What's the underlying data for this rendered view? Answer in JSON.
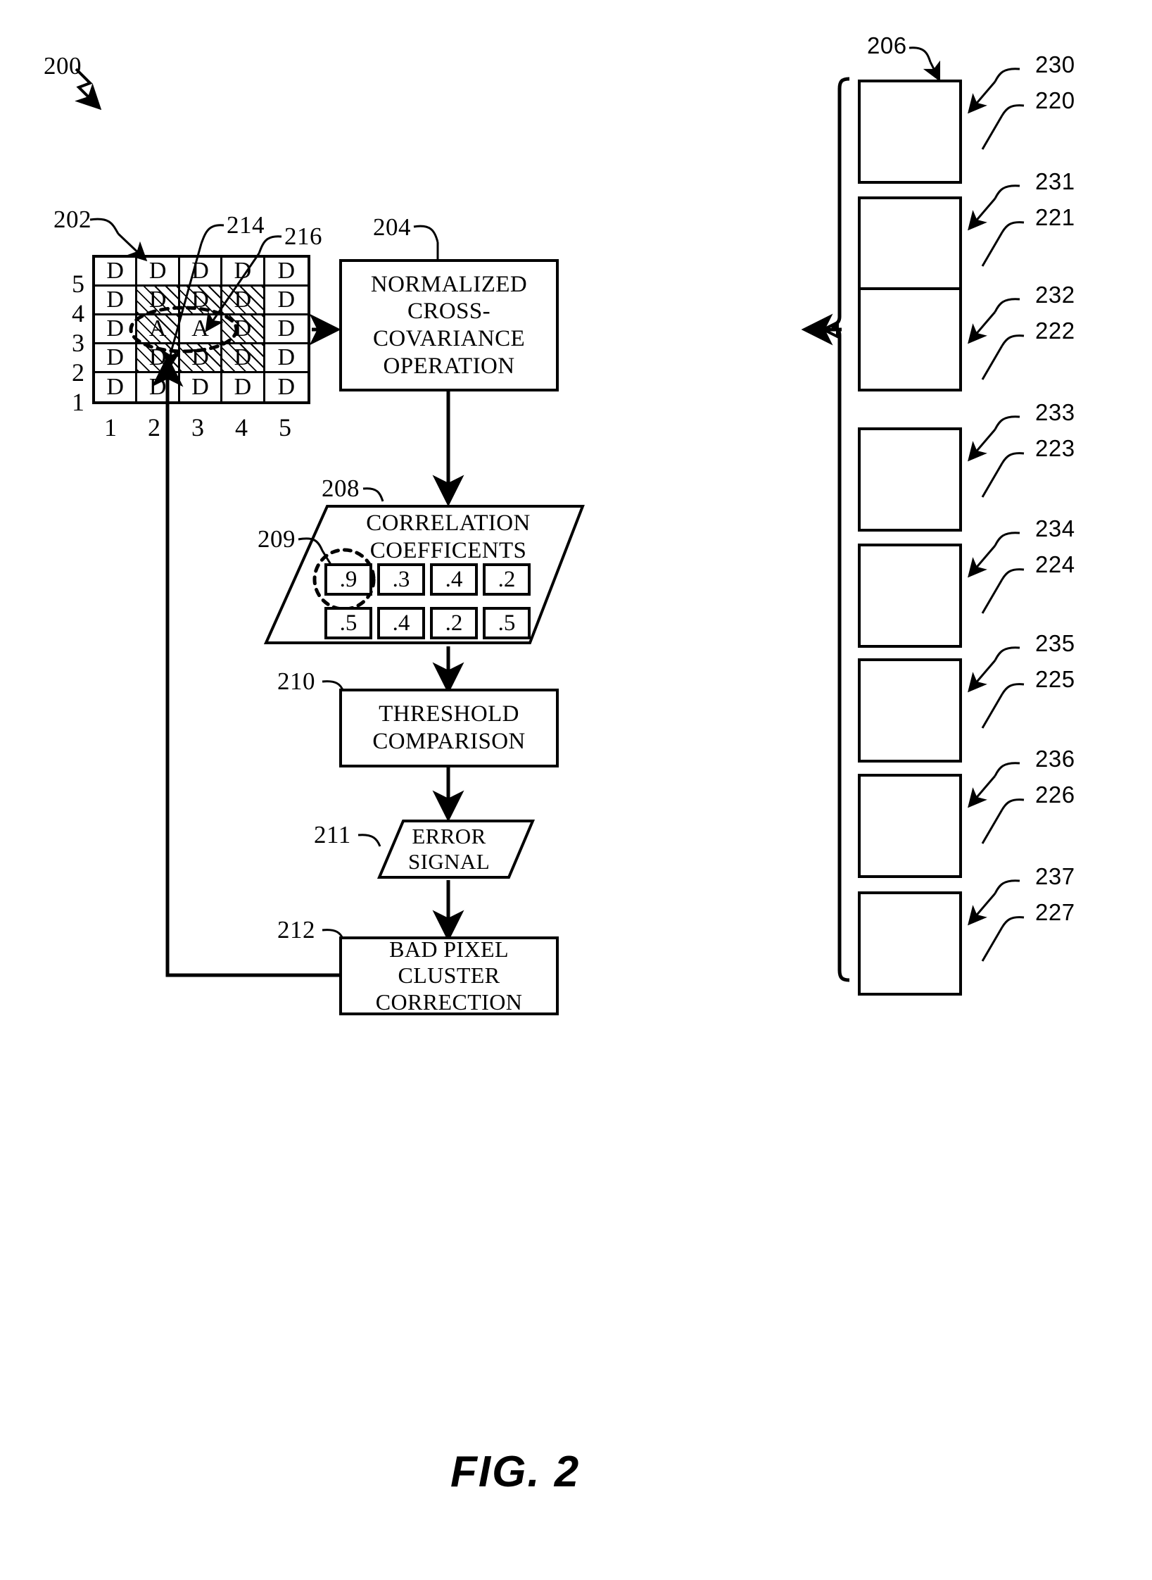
{
  "figure": {
    "caption": "FIG. 2",
    "top_ref": "200"
  },
  "pixel_grid": {
    "ref": "202",
    "callouts": [
      {
        "ref": "214"
      },
      {
        "ref": "216"
      }
    ],
    "row_labels": [
      "5",
      "4",
      "3",
      "2",
      "1"
    ],
    "col_labels": [
      "1",
      "2",
      "3",
      "4",
      "5"
    ],
    "rows": [
      {
        "label": "5",
        "cells": [
          {
            "text": "D",
            "hatched": false
          },
          {
            "text": "D",
            "hatched": false
          },
          {
            "text": "D",
            "hatched": false
          },
          {
            "text": "D",
            "hatched": false
          },
          {
            "text": "D",
            "hatched": false
          }
        ]
      },
      {
        "label": "4",
        "cells": [
          {
            "text": "D",
            "hatched": false
          },
          {
            "text": "D",
            "hatched": true
          },
          {
            "text": "D",
            "hatched": true
          },
          {
            "text": "D",
            "hatched": true
          },
          {
            "text": "D",
            "hatched": false
          }
        ]
      },
      {
        "label": "3",
        "cells": [
          {
            "text": "D",
            "hatched": false
          },
          {
            "text": "A",
            "hatched": true
          },
          {
            "text": "A",
            "hatched": false
          },
          {
            "text": "D",
            "hatched": true
          },
          {
            "text": "D",
            "hatched": false
          }
        ]
      },
      {
        "label": "2",
        "cells": [
          {
            "text": "D",
            "hatched": false
          },
          {
            "text": "D",
            "hatched": true
          },
          {
            "text": "D",
            "hatched": true
          },
          {
            "text": "D",
            "hatched": true
          },
          {
            "text": "D",
            "hatched": false
          }
        ]
      },
      {
        "label": "1",
        "cells": [
          {
            "text": "D",
            "hatched": false
          },
          {
            "text": "D",
            "hatched": false
          },
          {
            "text": "D",
            "hatched": false
          },
          {
            "text": "D",
            "hatched": false
          },
          {
            "text": "D",
            "hatched": false
          }
        ]
      }
    ]
  },
  "blocks": {
    "ncc": {
      "ref": "204",
      "label": "NORMALIZED\nCROSS-\nCOVARIANCE\nOPERATION"
    },
    "coefficients": {
      "ref": "208",
      "label": "CORRELATION\nCOEFFICENTS",
      "highlight_ref": "209"
    },
    "threshold": {
      "ref": "210",
      "label": "THRESHOLD\nCOMPARISON"
    },
    "error_signal": {
      "ref": "211",
      "label": "ERROR\nSIGNAL"
    },
    "correction": {
      "ref": "212",
      "label": "BAD PIXEL CLUSTER\nCORRECTION"
    }
  },
  "correlation_coefficients": {
    "row1": [
      ".9",
      ".3",
      ".4",
      ".2"
    ],
    "row2": [
      ".5",
      ".4",
      ".2",
      ".5"
    ]
  },
  "template_library": {
    "ref": "206",
    "panels": [
      {
        "arrow_ref": "230",
        "panel_ref": "220",
        "shape": "horizontal-capsule"
      },
      {
        "arrow_ref": "231",
        "panel_ref": "221",
        "shape": "diagonal-capsule-45"
      },
      {
        "arrow_ref": "232",
        "panel_ref": "222",
        "shape": "vertical-capsule"
      },
      {
        "arrow_ref": "233",
        "panel_ref": "223",
        "shape": "diagonal-capsule-45"
      },
      {
        "arrow_ref": "234",
        "panel_ref": "224",
        "shape": "horizontal-capsule"
      },
      {
        "arrow_ref": "235",
        "panel_ref": "225",
        "shape": "diagonal-capsule-45"
      },
      {
        "arrow_ref": "236",
        "panel_ref": "226",
        "shape": "vertical-capsule-small"
      },
      {
        "arrow_ref": "237",
        "panel_ref": "227",
        "shape": "diagonal-capsule-45"
      }
    ]
  },
  "colors": {
    "stroke": "#000000",
    "background": "#ffffff"
  }
}
